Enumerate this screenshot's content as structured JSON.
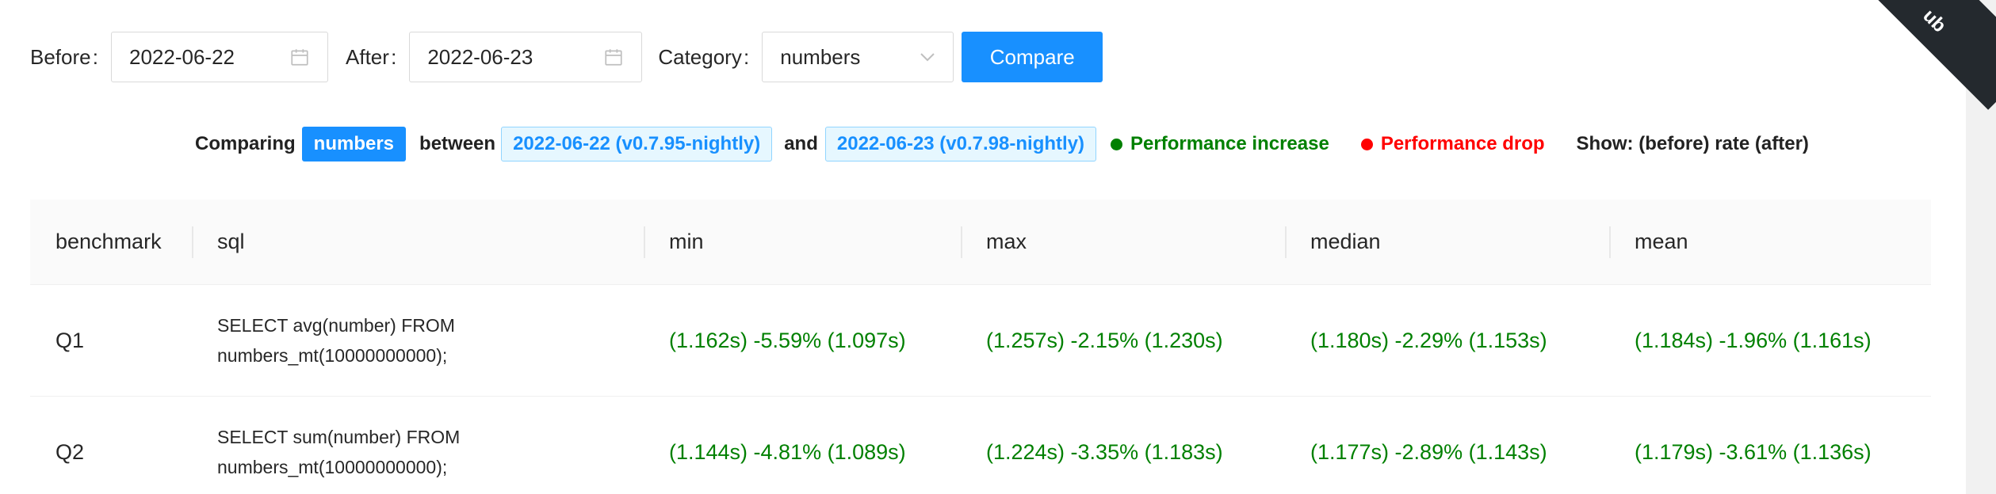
{
  "toolbar": {
    "before_label": "Before",
    "before_value": "2022-06-22",
    "after_label": "After",
    "after_value": "2022-06-23",
    "category_label": "Category",
    "category_value": "numbers",
    "compare_label": "Compare"
  },
  "ribbon": {
    "text": "ub"
  },
  "legend": {
    "comparing": "Comparing",
    "category": "numbers",
    "between": "between",
    "before_tag": "2022-06-22 (v0.7.95-nightly)",
    "and": "and",
    "after_tag": "2022-06-23 (v0.7.98-nightly)",
    "increase": "Performance increase",
    "drop": "Performance drop",
    "show": "Show: (before) rate (after)"
  },
  "colors": {
    "accent": "#1890ff",
    "increase": "#008000",
    "drop": "#ff0000"
  },
  "table": {
    "headers": [
      "benchmark",
      "sql",
      "min",
      "max",
      "median",
      "mean"
    ],
    "rows": [
      {
        "benchmark": "Q1",
        "sql_line1": "SELECT avg(number) FROM",
        "sql_line2": "numbers_mt(10000000000);",
        "min": "(1.162s) -5.59% (1.097s)",
        "max": "(1.257s) -2.15% (1.230s)",
        "median": "(1.180s) -2.29% (1.153s)",
        "mean": "(1.184s) -1.96% (1.161s)"
      },
      {
        "benchmark": "Q2",
        "sql_line1": "SELECT sum(number) FROM",
        "sql_line2": "numbers_mt(10000000000);",
        "min": "(1.144s) -4.81% (1.089s)",
        "max": "(1.224s) -3.35% (1.183s)",
        "median": "(1.177s) -2.89% (1.143s)",
        "mean": "(1.179s) -3.61% (1.136s)"
      }
    ]
  }
}
